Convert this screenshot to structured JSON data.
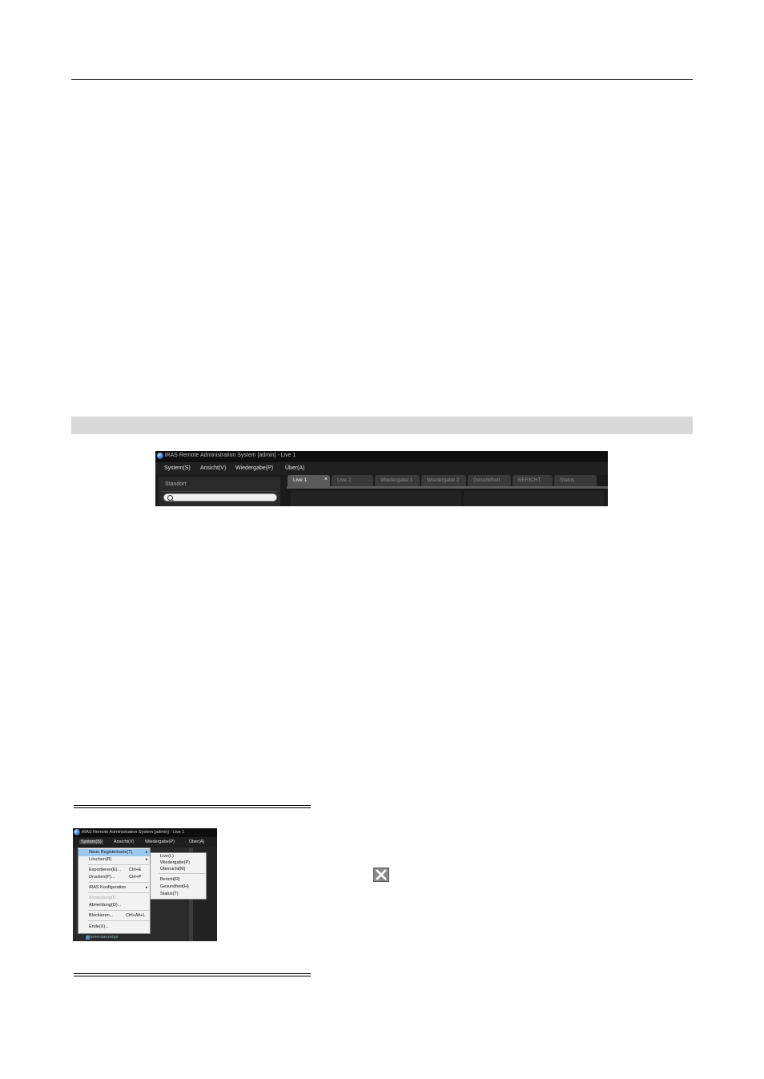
{
  "screenshot1": {
    "title": "iRAS Remote Administration System [admin] - Live 1",
    "menu": [
      "System(S)",
      "Ansicht(V)",
      "Wiedergabe(P)",
      "Über(A)"
    ],
    "sidebar_label": "Standort",
    "tabs": [
      "Live 1",
      "Live 2",
      "Wiedergabe 1",
      "Wiedergabe 2",
      "Gesundheit",
      "BERICHT",
      "Status"
    ],
    "tab_close": "×"
  },
  "screenshot2": {
    "title": "iRAS Remote Administration System [admin] - Live 1",
    "menu": [
      "System(S)",
      "Ansicht(V)",
      "Wiedergabe(P)",
      "Über(A)"
    ],
    "dropdown": [
      {
        "label": "Neue Registerkarte(T)",
        "shortcut": "",
        "arrow": "▸"
      },
      {
        "label": "Löschen(R)",
        "shortcut": "",
        "arrow": "▸"
      },
      {
        "label": "Exportieren(E)...",
        "shortcut": "Ctrl+E",
        "arrow": ""
      },
      {
        "label": "Drucken(P)...",
        "shortcut": "Ctrl+P",
        "arrow": ""
      },
      {
        "label": "iRAS Konfiguration",
        "shortcut": "",
        "arrow": "▸"
      },
      {
        "label": "Anmeldung(I)...",
        "shortcut": "",
        "arrow": ""
      },
      {
        "label": "Abmeldung(O)...",
        "shortcut": "",
        "arrow": ""
      },
      {
        "label": "Blockieren...",
        "shortcut": "Ctrl+Alt+L",
        "arrow": ""
      },
      {
        "label": "Ende(X)...",
        "shortcut": "",
        "arrow": ""
      }
    ],
    "submenu": [
      "Live(L)",
      "Wiedergabe(P)",
      "Übersicht(M)",
      "Bericht(R)",
      "Gesundheit(H)",
      "Status(T)"
    ],
    "bottom_item": "Kameraanzeige"
  }
}
